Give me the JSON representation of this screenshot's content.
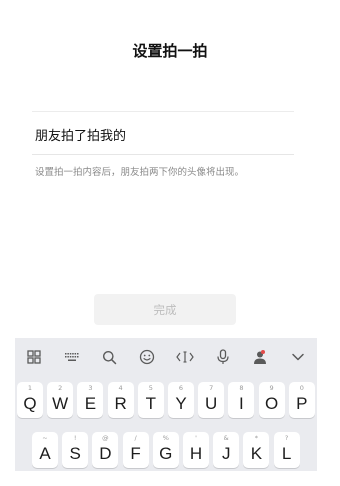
{
  "header": {
    "title": "设置拍一拍"
  },
  "form": {
    "value": "朋友拍了拍我的",
    "hint": "设置拍一拍内容后，朋友拍两下你的头像将出现。",
    "done_label": "完成"
  },
  "keyboard": {
    "toolbar": [
      {
        "icon": "grid-icon",
        "color": "#5a5a5a"
      },
      {
        "icon": "keyboard-icon",
        "color": "#5a5a5a"
      },
      {
        "icon": "search-icon",
        "color": "#5a5a5a"
      },
      {
        "icon": "emoji-icon",
        "color": "#5a5a5a"
      },
      {
        "icon": "cursor-icon",
        "color": "#5a5a5a"
      },
      {
        "icon": "microphone-icon",
        "color": "#5a5a5a"
      },
      {
        "icon": "avatar-icon",
        "color": "#5a5a5a"
      },
      {
        "icon": "collapse-icon",
        "color": "#5a5a5a"
      }
    ],
    "row1": [
      {
        "letter": "Q",
        "hint": "1"
      },
      {
        "letter": "W",
        "hint": "2"
      },
      {
        "letter": "E",
        "hint": "3"
      },
      {
        "letter": "R",
        "hint": "4"
      },
      {
        "letter": "T",
        "hint": "5"
      },
      {
        "letter": "Y",
        "hint": "6"
      },
      {
        "letter": "U",
        "hint": "7"
      },
      {
        "letter": "I",
        "hint": "8"
      },
      {
        "letter": "O",
        "hint": "9"
      },
      {
        "letter": "P",
        "hint": "0"
      }
    ],
    "row2": [
      {
        "letter": "A",
        "hint": "~"
      },
      {
        "letter": "S",
        "hint": "!"
      },
      {
        "letter": "D",
        "hint": "@"
      },
      {
        "letter": "F",
        "hint": "/"
      },
      {
        "letter": "G",
        "hint": "%"
      },
      {
        "letter": "H",
        "hint": "'"
      },
      {
        "letter": "J",
        "hint": "&"
      },
      {
        "letter": "K",
        "hint": "*"
      },
      {
        "letter": "L",
        "hint": "?"
      }
    ]
  }
}
